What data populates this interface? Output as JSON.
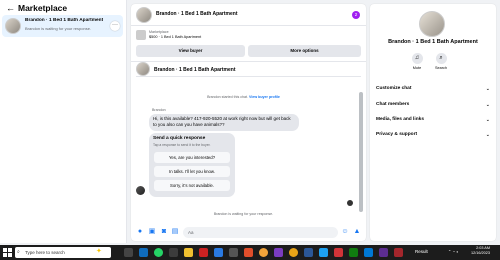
{
  "sidebar": {
    "title": "Marketplace",
    "item": {
      "title": "Brandon · 1 Bed 1 Bath Apartment",
      "subtitle": "Brandon is waiting for your response.",
      "more": "···"
    }
  },
  "chat": {
    "header_name": "Brandon · 1 Bed 1 Bath Apartment",
    "badge": "2",
    "listing": {
      "source": "Marketplace",
      "price": "$500 · 1 Bed 1 Bath Apartment",
      "view_buyer": "View buyer",
      "more_options": "More options"
    },
    "subheader_name": "Brandon · 1 Bed 1 Bath Apartment",
    "system_line": "Brandon started this chat.",
    "system_link": "View buyer profile",
    "sender": "Brandon",
    "message": "Hi, is this available? 417-920-5520 at work right now but will get back to you also can you have animals??",
    "quick_response": {
      "title": "Send a quick response",
      "subtitle": "Tap a response to send it to the buyer.",
      "options": [
        "Yes, are you interested?",
        "In talks. I'll let you know.",
        "Sorry, it's not available."
      ]
    },
    "waiting": "Brandon is waiting for your response.",
    "composer_placeholder": "Aa"
  },
  "details": {
    "name": "Brandon · 1 Bed 1 Bath Apartment",
    "mute": "Mute",
    "search": "Search",
    "sections": [
      "Customize chat",
      "Chat members",
      "Media, files and links",
      "Privacy & support"
    ]
  },
  "taskbar": {
    "search_placeholder": "Type here to search",
    "result": "Result",
    "time": "2:03 AM",
    "date": "12/16/2023"
  }
}
